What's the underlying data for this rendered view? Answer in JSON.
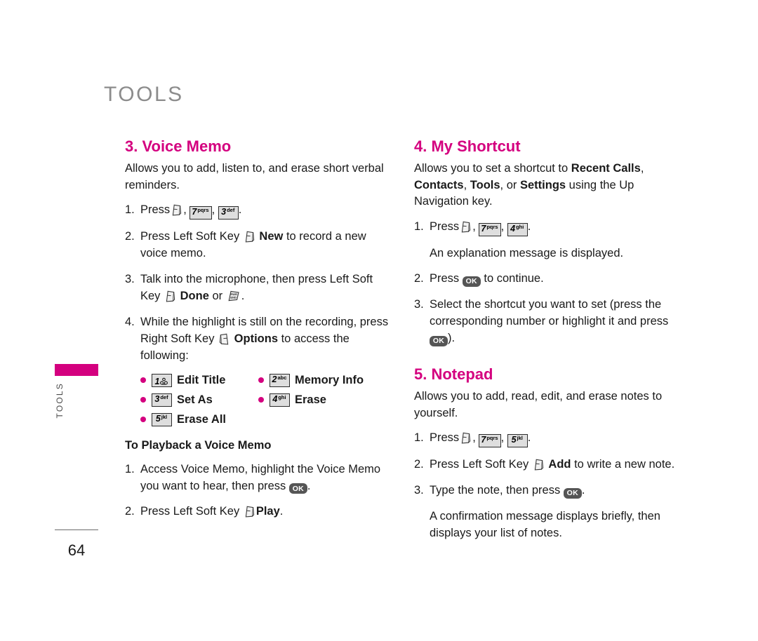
{
  "header": {
    "title": "TOOLS"
  },
  "margin_tab": {
    "label": "TOOLS",
    "color": "#d4007f"
  },
  "footer": {
    "page_number": "64"
  },
  "colors": {
    "accent": "#d4007f",
    "header_gray": "#8c8c8c",
    "keycap_fill": "#dedede",
    "ok_fill": "#555555"
  },
  "left_column": {
    "voice_memo": {
      "heading": "3. Voice Memo",
      "lead": "Allows you to add, listen to, and erase short verbal reminders.",
      "step1": {
        "num": "1.",
        "press": "Press",
        "end": "."
      },
      "step2": {
        "num": "2.",
        "pre": "Press Left Soft Key",
        "bold": "New",
        "post": "to record a new voice memo."
      },
      "step3": {
        "num": "3.",
        "pre": "Talk into the microphone, then press Left Soft Key",
        "bold": "Done",
        "mid": "or",
        "end": "."
      },
      "step4": {
        "num": "4.",
        "pre": "While the highlight is still on the recording, press Right Soft Key",
        "bold": "Options",
        "post": "to access the following:"
      },
      "options": [
        {
          "key_digit": "1",
          "key_sub": "vm",
          "label": "Edit Title"
        },
        {
          "key_digit": "2",
          "key_sub": "abc",
          "label": "Memory Info"
        },
        {
          "key_digit": "3",
          "key_sub": "def",
          "label": "Set As"
        },
        {
          "key_digit": "4",
          "key_sub": "ghi",
          "label": "Erase"
        },
        {
          "key_digit": "5",
          "key_sub": "jkl",
          "label": "Erase All"
        }
      ]
    },
    "playback": {
      "subhead": "To Playback a Voice Memo",
      "step1": {
        "num": "1.",
        "pre": "Access Voice Memo, highlight the Voice Memo you want to hear, then press",
        "end": "."
      },
      "step2": {
        "num": "2.",
        "pre": "Press Left Soft Key",
        "bold": "Play",
        "end": "."
      }
    },
    "keys": {
      "seven": {
        "digit": "7",
        "sub": "pqrs"
      },
      "three": {
        "digit": "3",
        "sub": "def"
      }
    }
  },
  "right_column": {
    "my_shortcut": {
      "heading": "4. My Shortcut",
      "lead_a": "Allows you to set a shortcut to ",
      "lead_b1": "Recent Calls",
      "lead_b2": "Contacts",
      "lead_b3": "Tools",
      "lead_b4": "Settings",
      "lead_c": ", or ",
      "lead_d": " using the Up Navigation key.",
      "step1": {
        "num": "1.",
        "press": "Press",
        "end": "."
      },
      "note1": "An explanation message is displayed.",
      "step2": {
        "num": "2.",
        "pre": "Press",
        "post": "to continue."
      },
      "step3": {
        "num": "3.",
        "pre": "Select the shortcut you want to set (press the corresponding number or highlight it and press",
        "end": ")."
      },
      "keys": {
        "seven": {
          "digit": "7",
          "sub": "pqrs"
        },
        "four": {
          "digit": "4",
          "sub": "ghi"
        }
      }
    },
    "notepad": {
      "heading": "5. Notepad",
      "lead": "Allows you to add, read, edit, and erase notes to yourself.",
      "step1": {
        "num": "1.",
        "press": "Press",
        "end": "."
      },
      "step2": {
        "num": "2.",
        "pre": "Press Left Soft Key",
        "bold": "Add",
        "post": "to write a new note."
      },
      "step3": {
        "num": "3.",
        "pre": "Type the note, then press",
        "end": "."
      },
      "note": "A confirmation message displays briefly, then displays your list of notes.",
      "keys": {
        "seven": {
          "digit": "7",
          "sub": "pqrs"
        },
        "five": {
          "digit": "5",
          "sub": "jkl"
        }
      }
    }
  },
  "icons": {
    "left_soft_key": "left-soft-key-icon",
    "right_soft_key": "right-soft-key-icon",
    "end_key": "end-key-icon",
    "ok_key": "ok-key-icon",
    "ok_label": "OK"
  }
}
